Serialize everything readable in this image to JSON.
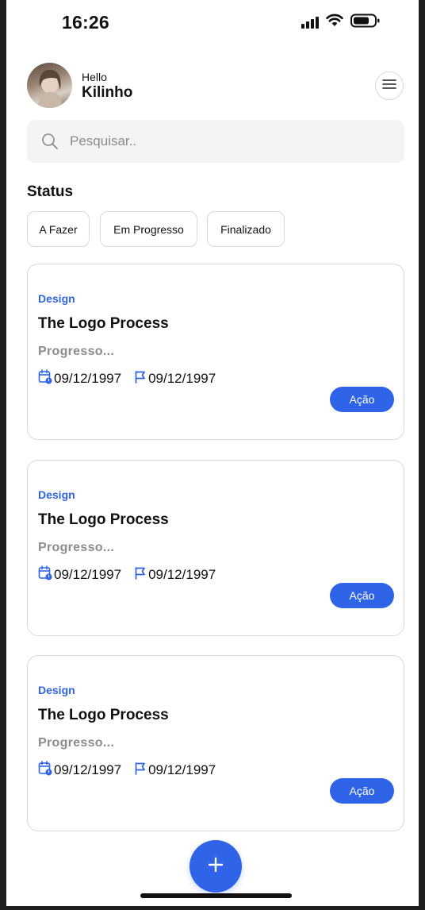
{
  "status_bar": {
    "time": "16:26",
    "icons": [
      "signal-icon",
      "wifi-icon",
      "battery-icon"
    ]
  },
  "header": {
    "greeting": "Hello",
    "user_name": "Kilinho",
    "menu_icon": "hamburger-menu-icon"
  },
  "search": {
    "placeholder": "Pesquisar..",
    "value": "",
    "icon": "search-icon"
  },
  "status_section": {
    "title": "Status",
    "filters": [
      {
        "label": "A Fazer"
      },
      {
        "label": "Em Progresso"
      },
      {
        "label": "Finalizado"
      }
    ]
  },
  "tasks": [
    {
      "category": "Design",
      "title": "The Logo Process",
      "status": "Progresso...",
      "start_date": "09/12/1997",
      "due_date": "09/12/1997",
      "action_label": "Ação"
    },
    {
      "category": "Design",
      "title": "The Logo Process",
      "status": "Progresso...",
      "start_date": "09/12/1997",
      "due_date": "09/12/1997",
      "action_label": "Ação"
    },
    {
      "category": "Design",
      "title": "The Logo Process",
      "status": "Progresso...",
      "start_date": "09/12/1997",
      "due_date": "09/12/1997",
      "action_label": "Ação"
    }
  ],
  "fab": {
    "icon": "plus-icon"
  },
  "colors": {
    "accent": "#2f64e9",
    "muted_text": "#8c8c8c",
    "border": "#d9d9d9",
    "search_bg": "#f4f4f4"
  }
}
